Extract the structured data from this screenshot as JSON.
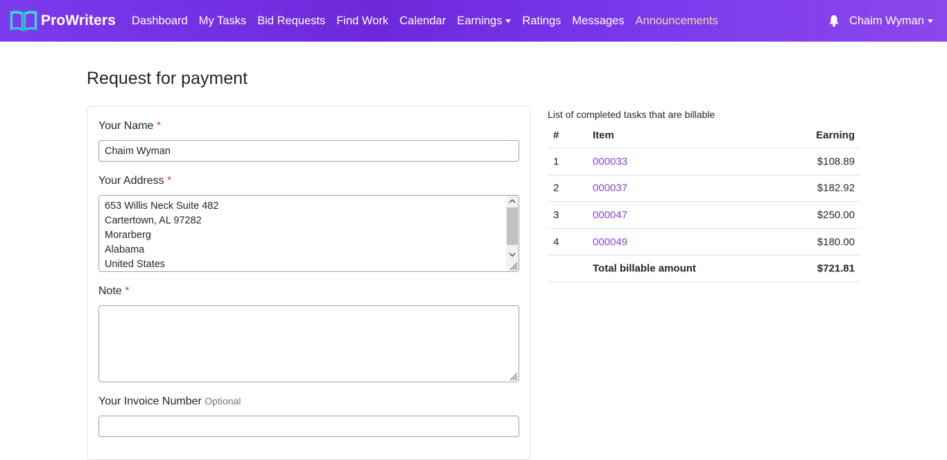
{
  "brand": {
    "name": "ProWriters"
  },
  "nav": {
    "items": [
      {
        "label": "Dashboard"
      },
      {
        "label": "My Tasks"
      },
      {
        "label": "Bid Requests"
      },
      {
        "label": "Find Work"
      },
      {
        "label": "Calendar"
      },
      {
        "label": "Earnings"
      },
      {
        "label": "Ratings"
      },
      {
        "label": "Messages"
      },
      {
        "label": "Announcements"
      }
    ],
    "user_name": "Chaim Wyman"
  },
  "page": {
    "title": "Request for payment"
  },
  "form": {
    "name_label": "Your Name",
    "name_value": "Chaim Wyman",
    "address_label": "Your Address",
    "address_lines": [
      "653 Willis Neck Suite 482",
      "Cartertown, AL 97282",
      "Morarberg",
      "Alabama",
      "United States"
    ],
    "note_label": "Note",
    "note_value": "",
    "invoice_label": "Your Invoice Number",
    "invoice_optional": "Optional",
    "invoice_value": "",
    "required_mark": "*"
  },
  "tasks": {
    "caption": "List of completed tasks that are billable",
    "headers": {
      "num": "#",
      "item": "Item",
      "earning": "Earning"
    },
    "rows": [
      {
        "num": "1",
        "item": "000033",
        "earning": "$108.89"
      },
      {
        "num": "2",
        "item": "000037",
        "earning": "$182.92"
      },
      {
        "num": "3",
        "item": "000047",
        "earning": "$250.00"
      },
      {
        "num": "4",
        "item": "000049",
        "earning": "$180.00"
      }
    ],
    "total_label": "Total billable amount",
    "total_value": "$721.81"
  },
  "icons": {
    "bell": "bell-icon",
    "logo": "book-logo-icon"
  },
  "colors": {
    "navbar": "#7c3aed",
    "link": "#8b3fd1",
    "active_nav": "#fcd7a0",
    "required": "#dc3545"
  }
}
